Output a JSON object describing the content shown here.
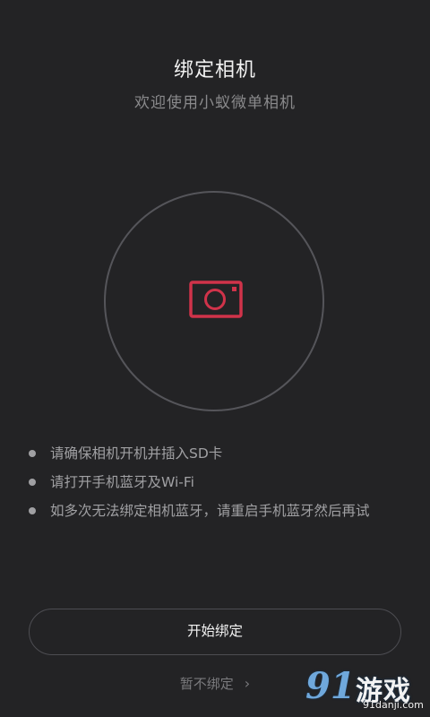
{
  "header": {
    "title": "绑定相机",
    "subtitle": "欢迎使用小蚁微单相机"
  },
  "camera": {
    "icon": "camera-icon",
    "accent_color": "#d0334a"
  },
  "tips": [
    {
      "text": "请确保相机开机并插入SD卡"
    },
    {
      "text": "请打开手机蓝牙及Wi-Fi"
    },
    {
      "text": "如多次无法绑定相机蓝牙，请重启手机蓝牙然后再试"
    }
  ],
  "actions": {
    "start_label": "开始绑定",
    "skip_label": "暂不绑定"
  },
  "watermark": {
    "number": "91",
    "text": "游戏",
    "url": "91danji.com"
  }
}
